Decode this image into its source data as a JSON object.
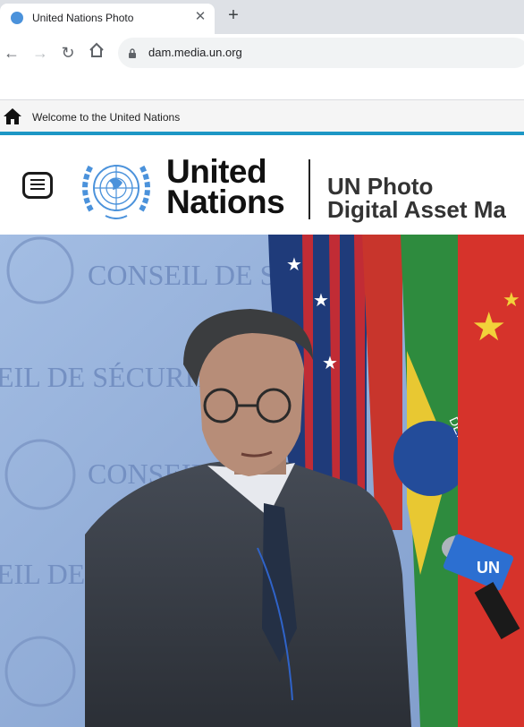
{
  "browser": {
    "tab_title": "United Nations Photo",
    "url": "dam.media.un.org"
  },
  "topbar": {
    "welcome_text": "Welcome to the United Nations"
  },
  "header": {
    "org_line1": "United",
    "org_line2": "Nations",
    "site_title_line1": "UN Photo",
    "site_title_line2": "Digital Asset Ma"
  },
  "hero": {
    "wall_text_1": "CONSEIL DE SÉC",
    "wall_text_2": "EIL DE SÉCURIT",
    "wall_text_3": "CONSEIL",
    "wall_text_4": "EIL DE",
    "flag_text": "DEM E PROGRE",
    "mic_text": "UN"
  },
  "colors": {
    "accent": "#1d97c5",
    "un_blue": "#4b92db"
  }
}
